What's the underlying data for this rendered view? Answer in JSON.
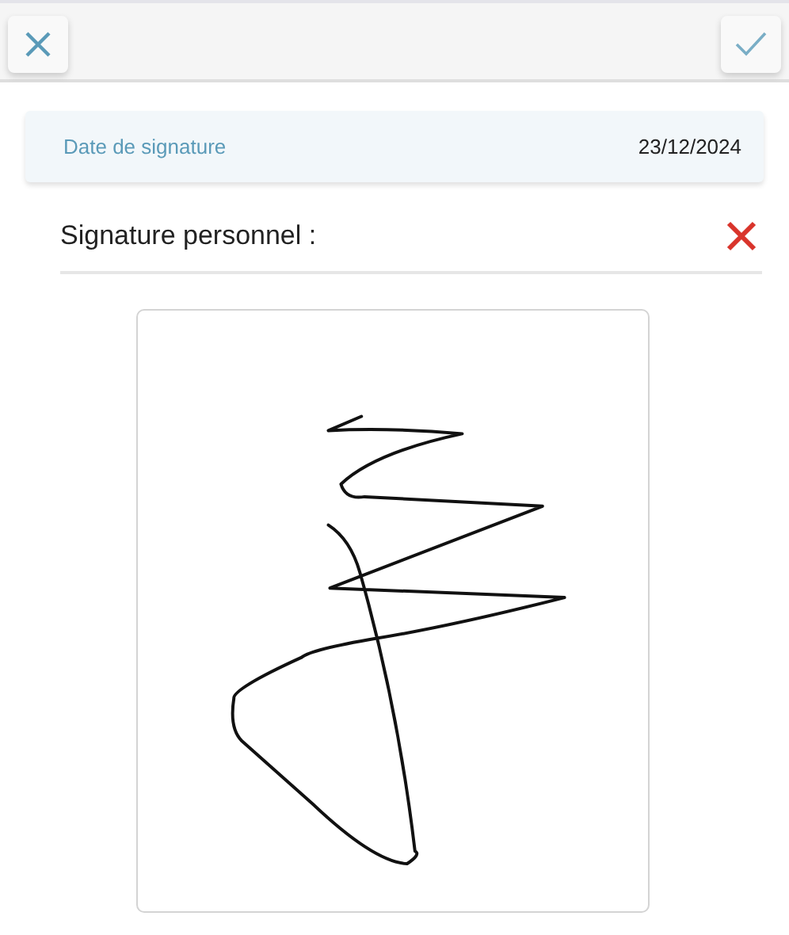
{
  "date_field": {
    "label": "Date de signature",
    "value": "23/12/2024"
  },
  "signature": {
    "label": "Signature personnel :"
  }
}
